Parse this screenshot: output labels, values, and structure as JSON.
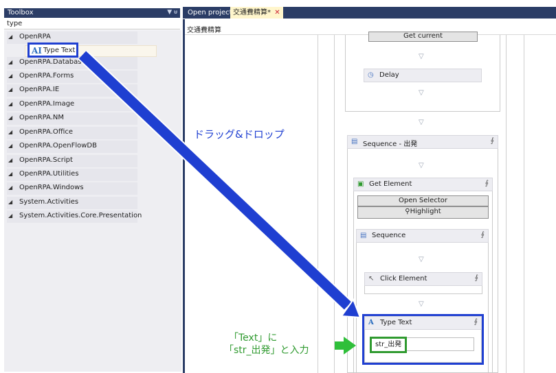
{
  "toolbox": {
    "title": "Toolbox",
    "controls": "▼ ᵾ",
    "search_value": "type",
    "categories": [
      {
        "label": "OpenRPA"
      },
      {
        "label": "OpenRPA.Database"
      },
      {
        "label": "OpenRPA.Forms"
      },
      {
        "label": "OpenRPA.IE"
      },
      {
        "label": "OpenRPA.Image"
      },
      {
        "label": "OpenRPA.NM"
      },
      {
        "label": "OpenRPA.Office"
      },
      {
        "label": "OpenRPA.OpenFlowDB"
      },
      {
        "label": "OpenRPA.Script"
      },
      {
        "label": "OpenRPA.Utilities"
      },
      {
        "label": "OpenRPA.Windows"
      },
      {
        "label": "System.Activities"
      },
      {
        "label": "System.Activities.Core.Presentation"
      }
    ],
    "expander": "◢",
    "tool_item": {
      "icon": "AI",
      "label": "Type Text"
    }
  },
  "tabs": [
    {
      "label": "Open project"
    },
    {
      "label": "交通費精算*",
      "close": "✕"
    }
  ],
  "breadcrumb": "交通費精算",
  "workflow": {
    "get_current_label": "Get current",
    "delay_label": "Delay",
    "sequence_outer_label": "Sequence - 出発",
    "get_element_label": "Get Element",
    "open_selector_label": "Open Selector",
    "highlight_label": "Highlight",
    "sequence_inner_label": "Sequence",
    "click_element_label": "Click Element",
    "type_text_label": "Type Text",
    "type_text_value": "str_出発",
    "collapse_glyph": "⨕"
  },
  "annotations": {
    "drag_drop": "ドラッグ&ドロップ",
    "instruction_line1": "「Text」に",
    "instruction_line2": "「str_出発」と入力"
  },
  "colors": {
    "accent_blue": "#1f3fd1",
    "accent_green": "#2f9a2f",
    "header_navy": "#2b3d66"
  }
}
